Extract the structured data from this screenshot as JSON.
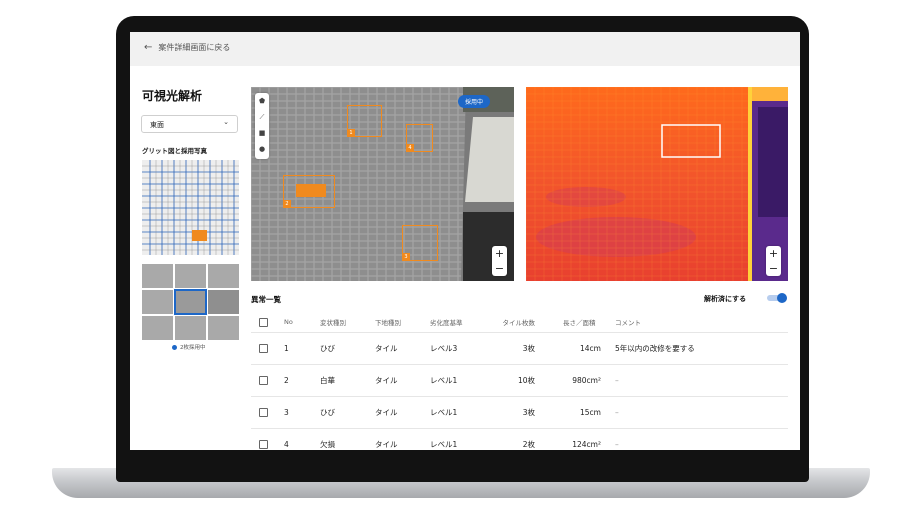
{
  "header": {
    "back_label": "案件詳細画面に戻る"
  },
  "page": {
    "title": "可視光解析"
  },
  "sidebar": {
    "direction_select": "東面",
    "grid_label": "グリット図と採用写真",
    "adopted_count": "2枚採用中"
  },
  "viewer": {
    "adopted_badge": "採用中",
    "markers": [
      "1",
      "2",
      "3",
      "4"
    ],
    "zoom_in": "+",
    "zoom_out": "−"
  },
  "anomalies": {
    "title": "異常一覧",
    "toggle_label": "解析済にする",
    "toggle_on": true,
    "columns": [
      "No",
      "変状種別",
      "下地種別",
      "劣化度基準",
      "タイル枚数",
      "長さ／面積",
      "コメント"
    ],
    "rows": [
      {
        "no": "1",
        "type": "ひび",
        "base": "タイル",
        "level": "レベル3",
        "tiles": "3枚",
        "size": "14cm",
        "comment": "5年以内の改修を要する"
      },
      {
        "no": "2",
        "type": "白華",
        "base": "タイル",
        "level": "レベル1",
        "tiles": "10枚",
        "size": "980cm²",
        "comment": "–"
      },
      {
        "no": "3",
        "type": "ひび",
        "base": "タイル",
        "level": "レベル1",
        "tiles": "3枚",
        "size": "15cm",
        "comment": "–"
      },
      {
        "no": "4",
        "type": "欠損",
        "base": "タイル",
        "level": "レベル1",
        "tiles": "2枚",
        "size": "124cm²",
        "comment": "–"
      }
    ]
  },
  "colors": {
    "accent": "#1d67c7",
    "marker": "#f08a1e"
  }
}
